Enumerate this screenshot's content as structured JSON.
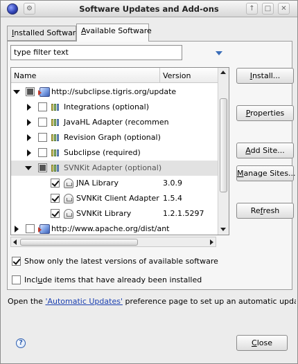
{
  "window": {
    "title": "Software Updates and Add-ons"
  },
  "tabs": {
    "installed": {
      "prefix": "I",
      "rest": "nstalled Software"
    },
    "available": {
      "prefix": "A",
      "rest": "vailable Software"
    }
  },
  "filter": {
    "value": "type filter text"
  },
  "tree": {
    "columns": {
      "name": "Name",
      "version": "Version"
    },
    "rows": [
      {
        "label": "http://subclipse.tigris.org/update",
        "version": ""
      },
      {
        "label": "Integrations (optional)",
        "version": ""
      },
      {
        "label": "JavaHL Adapter (recommen",
        "version": ""
      },
      {
        "label": "Revision Graph (optional)",
        "version": ""
      },
      {
        "label": "Subclipse (required)",
        "version": ""
      },
      {
        "label": "SVNKit Adapter (optional)",
        "version": ""
      },
      {
        "label": "JNA Library",
        "version": "3.0.9"
      },
      {
        "label": "SVNKit Client Adapter",
        "version": "1.5.4"
      },
      {
        "label": "SVNKit Library",
        "version": "1.2.1.5297"
      },
      {
        "label": "http://www.apache.org/dist/ant",
        "version": ""
      }
    ]
  },
  "buttons": {
    "install": {
      "mnemonic": "I",
      "rest": "nstall..."
    },
    "properties": {
      "mnemonic": "P",
      "rest": "roperties"
    },
    "add_site": {
      "mnemonic": "A",
      "rest": "dd Site..."
    },
    "manage_sites": {
      "mnemonic": "M",
      "rest": "anage Sites..."
    },
    "refresh": {
      "before": "Re",
      "mnemonic": "f",
      "rest": "resh"
    },
    "close": {
      "mnemonic": "C",
      "rest": "lose"
    }
  },
  "options": {
    "show_latest": {
      "label": "Show only the latest versions of available software",
      "checked": true
    },
    "include_installed": {
      "before": "Incl",
      "mnemonic": "u",
      "rest": "de items that have already been installed",
      "checked": false
    }
  },
  "info": {
    "before": "Open the ",
    "link": "'Automatic Updates'",
    "after": " preference page to set up an automatic update schedule."
  }
}
